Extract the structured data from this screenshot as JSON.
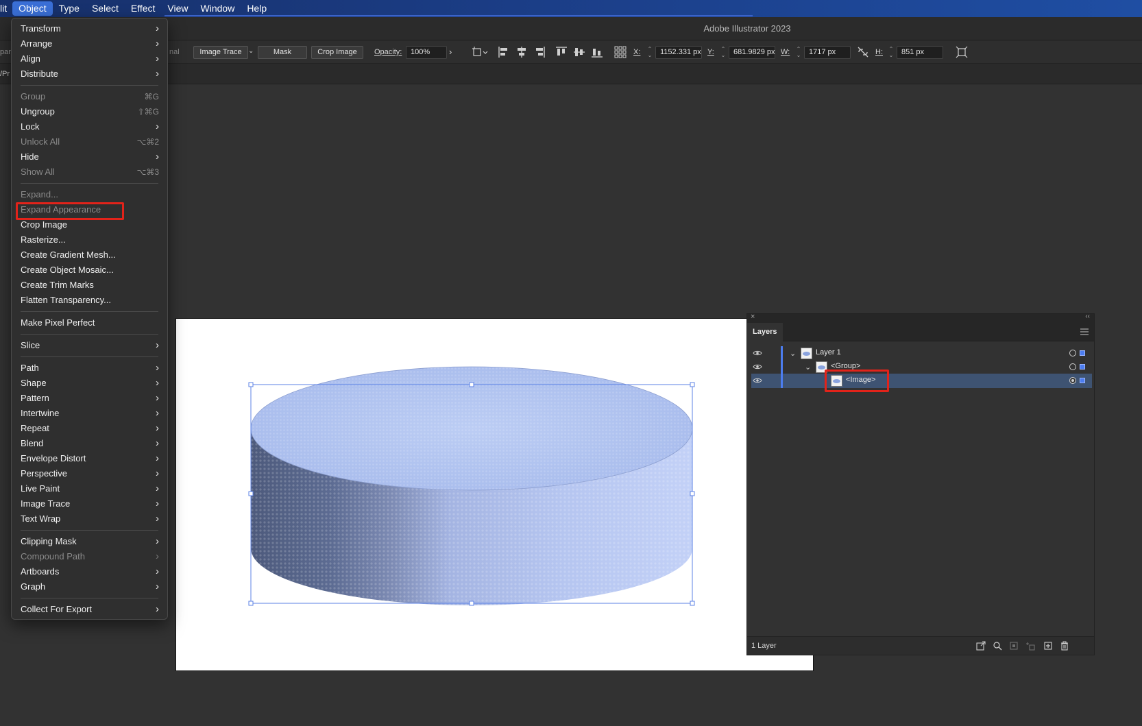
{
  "menubar": {
    "items": [
      {
        "label": "lit"
      },
      {
        "label": "Object"
      },
      {
        "label": "Type"
      },
      {
        "label": "Select"
      },
      {
        "label": "Effect"
      },
      {
        "label": "View"
      },
      {
        "label": "Window"
      },
      {
        "label": "Help"
      }
    ]
  },
  "app": {
    "title": "Adobe Illustrator 2023"
  },
  "controlbar": {
    "left_clip": "par",
    "left_clip2": "nal",
    "image_trace_label": "Image Trace",
    "mask_label": "Mask",
    "crop_image_label": "Crop Image",
    "opacity_label": "Opacity:",
    "opacity_value": "100%",
    "x_label": "X:",
    "x_value": "1152.331 px",
    "y_label": "Y:",
    "y_value": "681.9829 px",
    "w_label": "W:",
    "w_value": "1717 px",
    "h_label": "H:",
    "h_value": "851 px"
  },
  "docbar": {
    "clip_label": "/Pr"
  },
  "object_menu": {
    "sections": [
      [
        {
          "label": "Transform",
          "submenu": true
        },
        {
          "label": "Arrange",
          "submenu": true
        },
        {
          "label": "Align",
          "submenu": true
        },
        {
          "label": "Distribute",
          "submenu": true
        }
      ],
      [
        {
          "label": "Group",
          "shortcut": "⌘G",
          "disabled": true
        },
        {
          "label": "Ungroup",
          "shortcut": "⇧⌘G"
        },
        {
          "label": "Lock",
          "submenu": true
        },
        {
          "label": "Unlock All",
          "shortcut": "⌥⌘2",
          "disabled": true
        },
        {
          "label": "Hide",
          "submenu": true
        },
        {
          "label": "Show All",
          "shortcut": "⌥⌘3",
          "disabled": true
        }
      ],
      [
        {
          "label": "Expand...",
          "disabled": true
        },
        {
          "label": "Expand Appearance",
          "disabled": true,
          "highlighted": true
        },
        {
          "label": "Crop Image"
        },
        {
          "label": "Rasterize..."
        },
        {
          "label": "Create Gradient Mesh..."
        },
        {
          "label": "Create Object Mosaic..."
        },
        {
          "label": "Create Trim Marks"
        },
        {
          "label": "Flatten Transparency..."
        }
      ],
      [
        {
          "label": "Make Pixel Perfect"
        }
      ],
      [
        {
          "label": "Slice",
          "submenu": true
        }
      ],
      [
        {
          "label": "Path",
          "submenu": true
        },
        {
          "label": "Shape",
          "submenu": true
        },
        {
          "label": "Pattern",
          "submenu": true
        },
        {
          "label": "Intertwine",
          "submenu": true
        },
        {
          "label": "Repeat",
          "submenu": true
        },
        {
          "label": "Blend",
          "submenu": true
        },
        {
          "label": "Envelope Distort",
          "submenu": true
        },
        {
          "label": "Perspective",
          "submenu": true
        },
        {
          "label": "Live Paint",
          "submenu": true
        },
        {
          "label": "Image Trace",
          "submenu": true
        },
        {
          "label": "Text Wrap",
          "submenu": true
        }
      ],
      [
        {
          "label": "Clipping Mask",
          "submenu": true
        },
        {
          "label": "Compound Path",
          "submenu": true,
          "disabled": true
        },
        {
          "label": "Artboards",
          "submenu": true
        },
        {
          "label": "Graph",
          "submenu": true
        }
      ],
      [
        {
          "label": "Collect For Export",
          "submenu": true
        }
      ]
    ]
  },
  "layers_panel": {
    "tab_label": "Layers",
    "rows": [
      {
        "name": "Layer 1",
        "depth": 0,
        "expanded": true,
        "selected": false
      },
      {
        "name": "<Group>",
        "depth": 1,
        "expanded": true,
        "selected": false
      },
      {
        "name": "<Image>",
        "depth": 2,
        "expanded": false,
        "selected": true
      }
    ],
    "footer_count": "1 Layer"
  },
  "colors": {
    "menubar": "#1b3d86",
    "menu_active": "#3a6fd6",
    "highlight_box": "#e2231a",
    "layer_color": "#4c7df0",
    "selection_row": "#3e5372",
    "cylinder_top": "#b7c8f0",
    "cylinder_side_dark": "#5b6a8e"
  }
}
